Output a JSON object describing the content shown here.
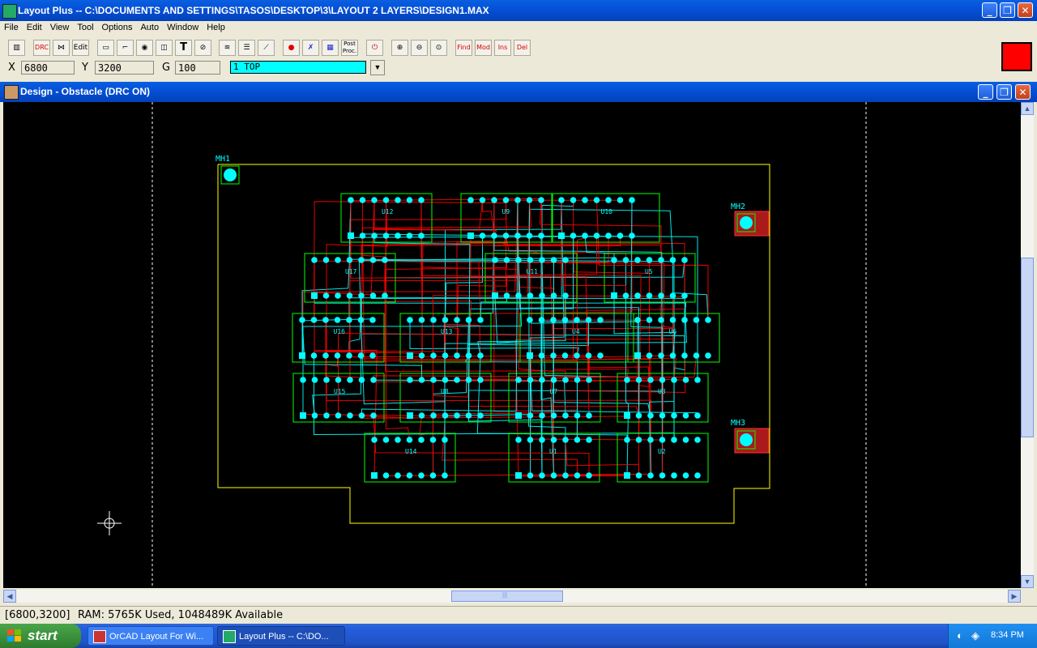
{
  "window": {
    "title": "Layout Plus -- C:\\DOCUMENTS AND SETTINGS\\TASOS\\DESKTOP\\3\\LAYOUT 2 LAYERS\\DESIGN1.MAX",
    "minimize": "_",
    "maximize": "❐",
    "close": "✕"
  },
  "menu": [
    "File",
    "Edit",
    "View",
    "Tool",
    "Options",
    "Auto",
    "Window",
    "Help"
  ],
  "toolbar": {
    "drc": "DRC",
    "edit": "Edit",
    "text_tool": "T",
    "post_proc": "Post Proc.",
    "find": "Find",
    "mod": "Mod",
    "ins": "Ins",
    "del": "Del"
  },
  "coords": {
    "x_label": "X",
    "x_value": "6800",
    "y_label": "Y",
    "y_value": "3200",
    "g_label": "G",
    "g_value": "100",
    "layer": "1 TOP",
    "dropdown_arrow": "▼"
  },
  "design_window": {
    "title": "Design - Obstacle (DRC ON)",
    "minimize": "_",
    "maximize": "❐",
    "close": "✕"
  },
  "board": {
    "mounting_holes": [
      "MH1",
      "MH2",
      "MH3"
    ],
    "components": [
      "U12",
      "U9",
      "U10",
      "U17",
      "U11",
      "U5",
      "U16",
      "U13",
      "U4",
      "U6",
      "U15",
      "U8",
      "U7",
      "U3",
      "U14",
      "U1",
      "U2"
    ],
    "colors": {
      "background": "#000000",
      "outline": "#ffff00",
      "pads": "#00ffff",
      "component_outline": "#00ff00",
      "top_trace": "#ff0000",
      "bottom_trace": "#00ffff",
      "obstacle_fill": "#cc2222"
    }
  },
  "scroll": {
    "left": "◀",
    "right": "▶",
    "up": "▲",
    "down": "▼",
    "grip": "|||"
  },
  "status": {
    "coord": "[6800,3200]",
    "ram": "RAM: 5765K Used, 1048489K Available"
  },
  "taskbar": {
    "start": "start",
    "items": [
      "OrCAD Layout For Wi...",
      "Layout Plus -- C:\\DO..."
    ],
    "clock": "8:34 PM"
  }
}
